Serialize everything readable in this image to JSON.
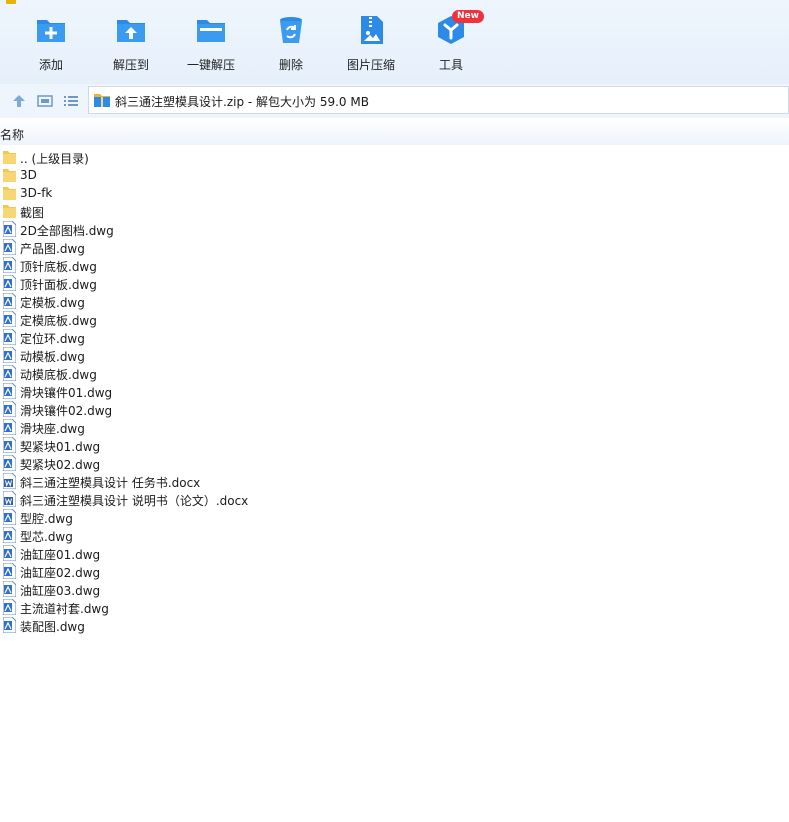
{
  "toolbar": {
    "items": [
      {
        "label": "添加",
        "icon": "add-icon"
      },
      {
        "label": "解压到",
        "icon": "extract-to-icon"
      },
      {
        "label": "一键解压",
        "icon": "one-click-extract-icon"
      },
      {
        "label": "删除",
        "icon": "delete-icon"
      },
      {
        "label": "图片压缩",
        "icon": "image-compress-icon"
      },
      {
        "label": "工具",
        "icon": "tools-icon"
      }
    ],
    "new_badge": "New"
  },
  "address": {
    "path": "斜三通注塑模具设计.zip - 解包大小为 59.0 MB"
  },
  "columns": {
    "name": "名称"
  },
  "files": [
    {
      "name": ".. (上级目录)",
      "type": "folder"
    },
    {
      "name": "3D",
      "type": "folder"
    },
    {
      "name": "3D-fk",
      "type": "folder"
    },
    {
      "name": "截图",
      "type": "folder"
    },
    {
      "name": "2D全部图档.dwg",
      "type": "dwg"
    },
    {
      "name": "产品图.dwg",
      "type": "dwg"
    },
    {
      "name": "顶针底板.dwg",
      "type": "dwg"
    },
    {
      "name": "顶针面板.dwg",
      "type": "dwg"
    },
    {
      "name": "定模板.dwg",
      "type": "dwg"
    },
    {
      "name": "定模底板.dwg",
      "type": "dwg"
    },
    {
      "name": "定位环.dwg",
      "type": "dwg"
    },
    {
      "name": "动模板.dwg",
      "type": "dwg"
    },
    {
      "name": "动模底板.dwg",
      "type": "dwg"
    },
    {
      "name": "滑块镶件01.dwg",
      "type": "dwg"
    },
    {
      "name": "滑块镶件02.dwg",
      "type": "dwg"
    },
    {
      "name": "滑块座.dwg",
      "type": "dwg"
    },
    {
      "name": "契紧块01.dwg",
      "type": "dwg"
    },
    {
      "name": "契紧块02.dwg",
      "type": "dwg"
    },
    {
      "name": "斜三通注塑模具设计 任务书.docx",
      "type": "docx"
    },
    {
      "name": "斜三通注塑模具设计 说明书（论文）.docx",
      "type": "docx"
    },
    {
      "name": "型腔.dwg",
      "type": "dwg"
    },
    {
      "name": "型芯.dwg",
      "type": "dwg"
    },
    {
      "name": "油缸座01.dwg",
      "type": "dwg"
    },
    {
      "name": "油缸座02.dwg",
      "type": "dwg"
    },
    {
      "name": "油缸座03.dwg",
      "type": "dwg"
    },
    {
      "name": "主流道衬套.dwg",
      "type": "dwg"
    },
    {
      "name": "装配图.dwg",
      "type": "dwg"
    }
  ],
  "colors": {
    "accent": "#2b8be6",
    "folder": "#f7d774",
    "badge": "#f0323c"
  }
}
